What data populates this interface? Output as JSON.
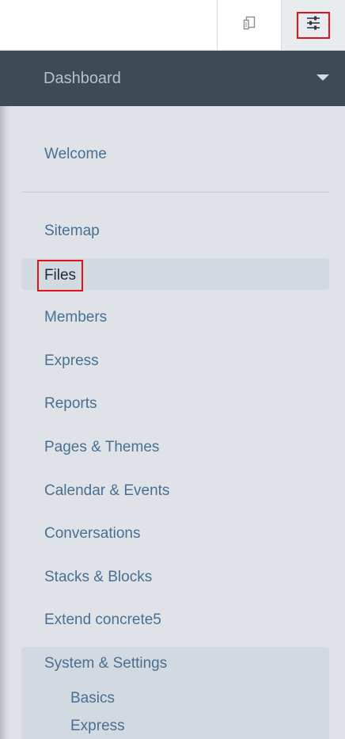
{
  "toolbar": {
    "sitemap_icon": "pages-icon",
    "dashboard_icon": "sliders-icon"
  },
  "panel": {
    "header_title": "Dashboard",
    "welcome": "Welcome",
    "items": {
      "sitemap": "Sitemap",
      "files": "Files",
      "members": "Members",
      "express": "Express",
      "reports": "Reports",
      "pages_themes": "Pages & Themes",
      "calendar_events": "Calendar & Events",
      "conversations": "Conversations",
      "stacks_blocks": "Stacks & Blocks",
      "extend": "Extend concrete5",
      "system_settings": "System & Settings"
    },
    "sub_items": {
      "basics": "Basics",
      "express": "Express"
    }
  },
  "colors": {
    "header_bg": "#3e4a55",
    "panel_bg": "#dfe3e8",
    "link": "#4a6f93",
    "highlight_box": "#e3121a"
  }
}
